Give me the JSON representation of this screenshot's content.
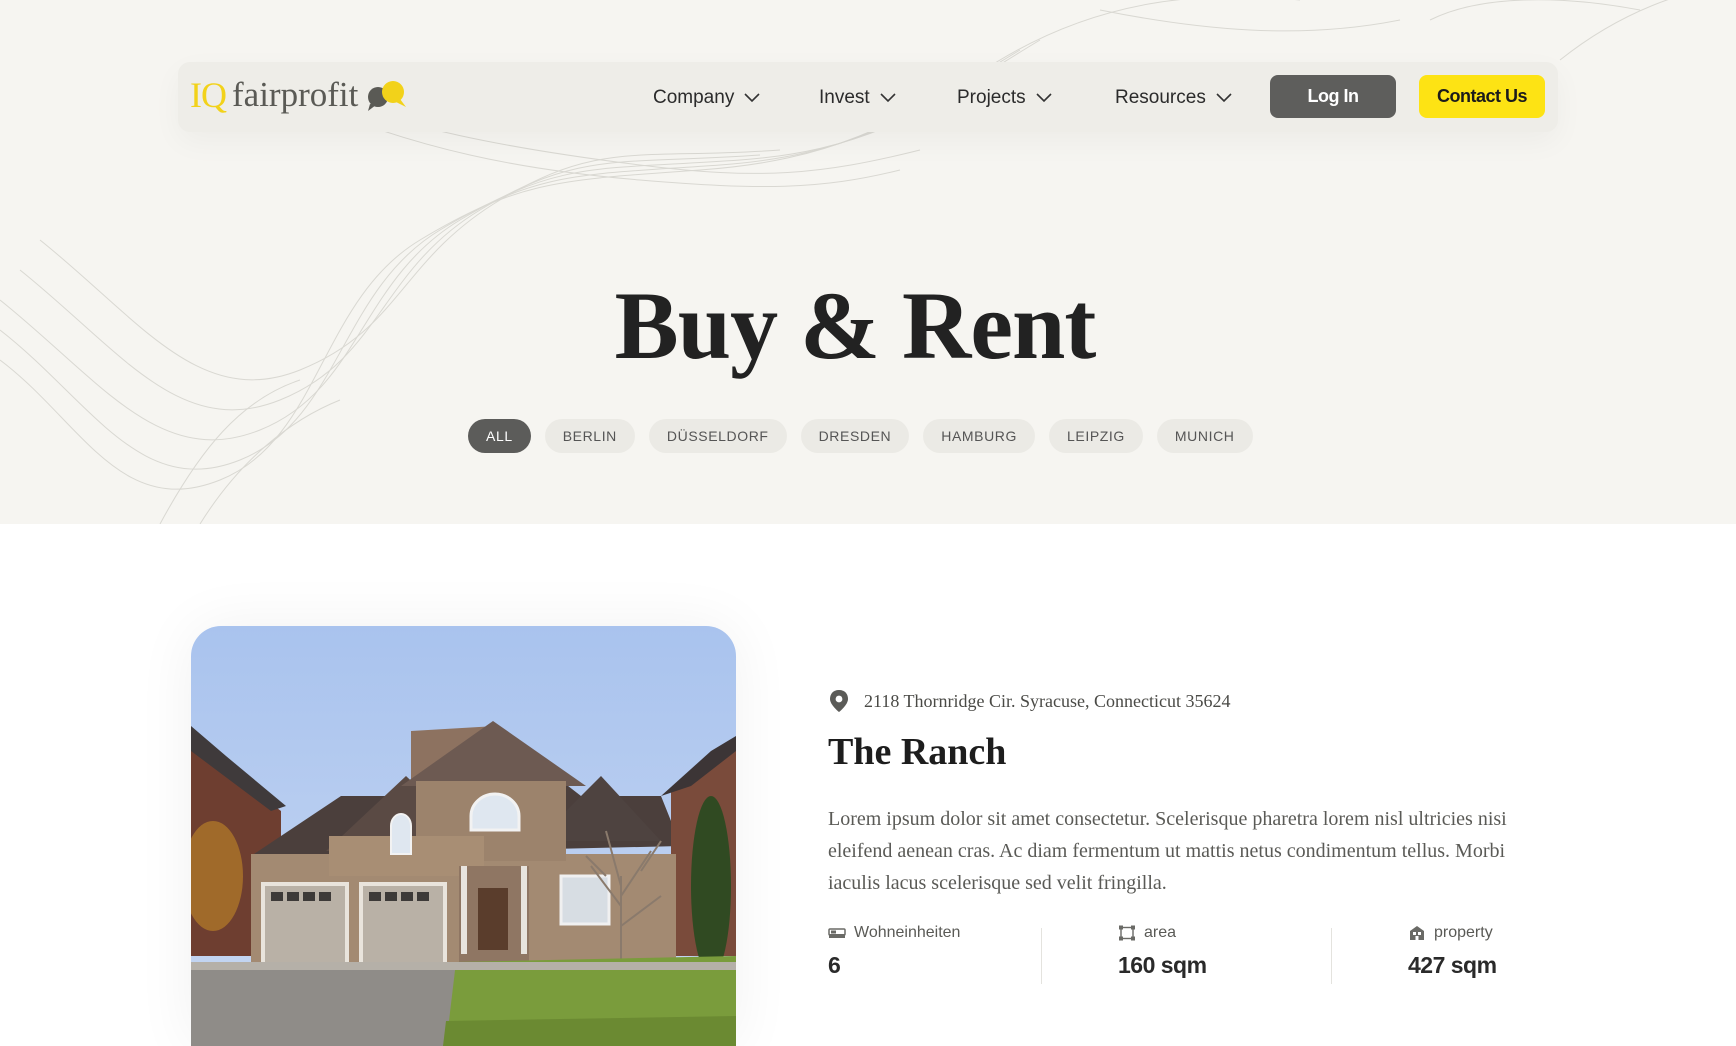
{
  "brand": {
    "iq": "IQ",
    "name": "fairprofit"
  },
  "nav": {
    "items": [
      {
        "label": "Company"
      },
      {
        "label": "Invest"
      },
      {
        "label": "Projects"
      },
      {
        "label": "Resources"
      }
    ],
    "login_label": "Log In",
    "contact_label": "Contact Us"
  },
  "hero": {
    "title": "Buy & Rent",
    "filters": [
      "ALL",
      "BERLIN",
      "DÜSSELDORF",
      "DRESDEN",
      "HAMBURG",
      "LEIPZIG",
      "MUNICH"
    ],
    "active_filter": "ALL"
  },
  "listing": {
    "address": "2118 Thornridge Cir. Syracuse, Connecticut 35624",
    "title": "The Ranch",
    "description": "Lorem ipsum dolor sit amet consectetur. Scelerisque pharetra lorem nisl ultricies nisi eleifend aenean cras. Ac diam fermentum ut mattis netus condimentum tellus. Morbi iaculis lacus scelerisque sed velit fringilla.",
    "stats": [
      {
        "label": "Wohneinheiten",
        "value": "6",
        "icon": "bed-icon"
      },
      {
        "label": "area",
        "value": "160 sqm",
        "icon": "area-icon"
      },
      {
        "label": "property",
        "value": "427 sqm",
        "icon": "building-icon"
      }
    ]
  },
  "colors": {
    "accent_yellow": "#fde314",
    "dark_button": "#5e5e5c",
    "hero_bg": "#f6f5f1"
  }
}
